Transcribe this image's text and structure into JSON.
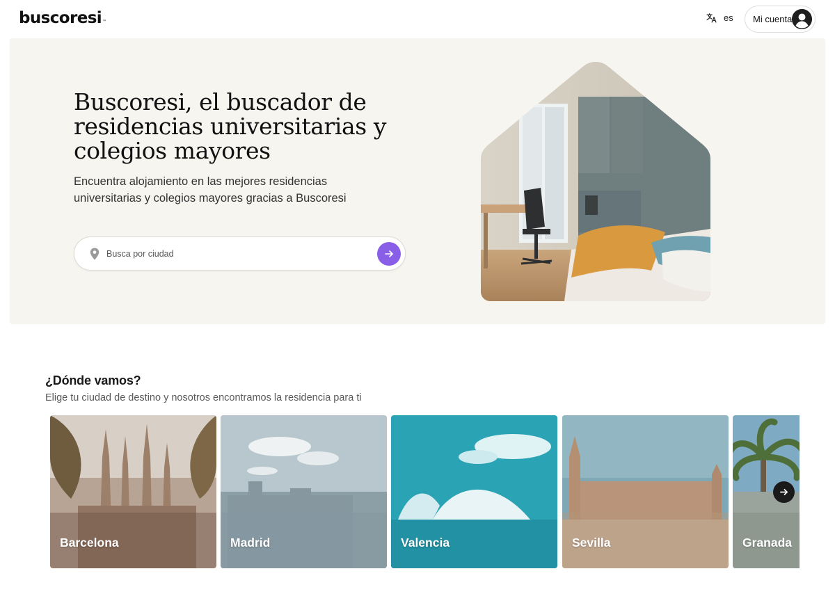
{
  "header": {
    "logo": "buscoresi",
    "logo_mark": "™",
    "language": "es",
    "account_label": "Mi cuenta",
    "icons": {
      "language": "translate-icon",
      "account": "user-avatar-icon"
    }
  },
  "hero": {
    "title": "Buscoresi, el buscador de residencias universitarias y colegios mayores",
    "subtitle": "Encuentra alojamiento en las mejores residencias universitarias y colegios mayores gracias a Buscoresi",
    "search": {
      "placeholder": "Busca por ciudad",
      "value": ""
    }
  },
  "destinations": {
    "title": "¿Dónde vamos?",
    "subtitle": "Elige tu ciudad de destino y nosotros encontramos la residencia para ti",
    "cities": [
      {
        "name": "Barcelona",
        "color": "#8a6f5e"
      },
      {
        "name": "Madrid",
        "color": "#8fa3ad"
      },
      {
        "name": "Valencia",
        "color": "#2aa3b5"
      },
      {
        "name": "Sevilla",
        "color": "#b59a84"
      },
      {
        "name": "Granada",
        "color": "#8c9590"
      }
    ]
  },
  "colors": {
    "accent": "#8a5fe8",
    "hero_bg": "#f7f5f0",
    "text": "#1a1a1a"
  }
}
